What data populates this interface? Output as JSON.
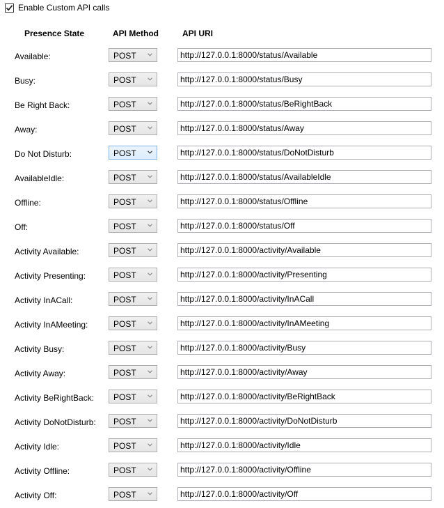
{
  "enable_custom_api": {
    "label": "Enable Custom API calls",
    "checked": true
  },
  "headers": {
    "state": "Presence State",
    "method": "API Method",
    "uri": "API URI"
  },
  "rows": [
    {
      "label": "Available:",
      "method": "POST",
      "uri": "http://127.0.0.1:8000/status/Available"
    },
    {
      "label": "Busy:",
      "method": "POST",
      "uri": "http://127.0.0.1:8000/status/Busy"
    },
    {
      "label": "Be Right Back:",
      "method": "POST",
      "uri": "http://127.0.0.1:8000/status/BeRightBack"
    },
    {
      "label": "Away:",
      "method": "POST",
      "uri": "http://127.0.0.1:8000/status/Away"
    },
    {
      "label": "Do Not Disturb:",
      "method": "POST",
      "uri": "http://127.0.0.1:8000/status/DoNotDisturb",
      "focused": true
    },
    {
      "label": "AvailableIdle:",
      "method": "POST",
      "uri": "http://127.0.0.1:8000/status/AvailableIdle"
    },
    {
      "label": "Offline:",
      "method": "POST",
      "uri": "http://127.0.0.1:8000/status/Offline"
    },
    {
      "label": "Off:",
      "method": "POST",
      "uri": "http://127.0.0.1:8000/status/Off"
    },
    {
      "label": "Activity Available:",
      "method": "POST",
      "uri": "http://127.0.0.1:8000/activity/Available"
    },
    {
      "label": "Activity Presenting:",
      "method": "POST",
      "uri": "http://127.0.0.1:8000/activity/Presenting"
    },
    {
      "label": "Activity InACall:",
      "method": "POST",
      "uri": "http://127.0.0.1:8000/activity/InACall"
    },
    {
      "label": "Activity InAMeeting:",
      "method": "POST",
      "uri": "http://127.0.0.1:8000/activity/InAMeeting"
    },
    {
      "label": "Activity Busy:",
      "method": "POST",
      "uri": "http://127.0.0.1:8000/activity/Busy"
    },
    {
      "label": "Activity Away:",
      "method": "POST",
      "uri": "http://127.0.0.1:8000/activity/Away"
    },
    {
      "label": "Activity BeRightBack:",
      "method": "POST",
      "uri": "http://127.0.0.1:8000/activity/BeRightBack"
    },
    {
      "label": "Activity DoNotDisturb:",
      "method": "POST",
      "uri": "http://127.0.0.1:8000/activity/DoNotDisturb"
    },
    {
      "label": "Activity Idle:",
      "method": "POST",
      "uri": "http://127.0.0.1:8000/activity/Idle"
    },
    {
      "label": "Activity Offline:",
      "method": "POST",
      "uri": "http://127.0.0.1:8000/activity/Offline"
    },
    {
      "label": "Activity Off:",
      "method": "POST",
      "uri": "http://127.0.0.1:8000/activity/Off"
    }
  ]
}
